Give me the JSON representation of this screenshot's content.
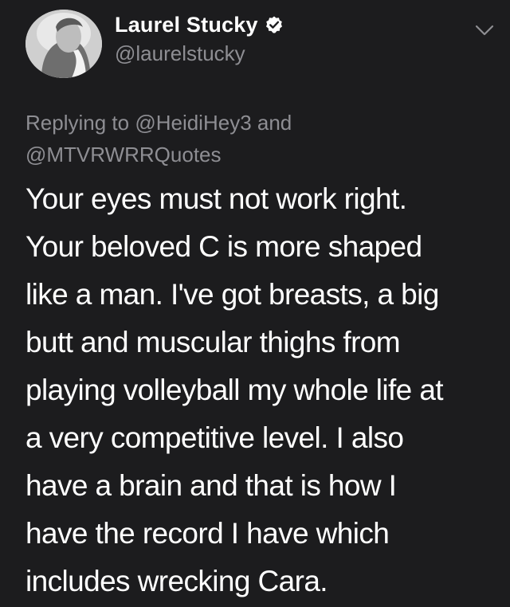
{
  "author": {
    "display_name": "Laurel Stucky",
    "handle": "@laurelstucky",
    "verified": true,
    "avatar": "grayscale-profile-photo"
  },
  "icons": {
    "verified": "verified-badge-icon",
    "menu": "chevron-down-icon"
  },
  "reply": {
    "prefix": "Replying to",
    "mention_1": "@HeidiHey3",
    "joiner": "and",
    "mention_2": "@MTVRWRRQuotes"
  },
  "tweet": {
    "lines": [
      "Your eyes must not work right.",
      "Your beloved C is more shaped",
      "like a man. I've got breasts, a big",
      "butt and muscular thighs from",
      "playing volleyball my whole life at",
      "a very competitive level. I also",
      "have a brain and that is how I",
      "have the record I have which",
      "includes wrecking Cara."
    ]
  },
  "colors": {
    "background": "#1c1c1e",
    "primary_text": "#ffffff",
    "secondary_text": "#8e8e93"
  }
}
